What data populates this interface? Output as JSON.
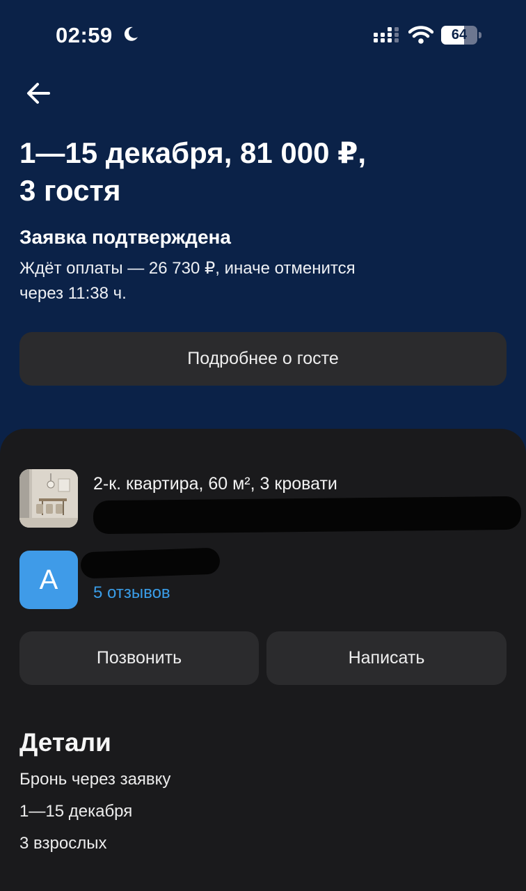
{
  "status_bar": {
    "time": "02:59",
    "battery_level": "64",
    "battery_fraction": 0.64,
    "icons": [
      "moon-icon",
      "signal-icon",
      "wifi-icon",
      "battery-icon"
    ]
  },
  "header": {
    "back_icon": "arrow-left-icon",
    "title_line1": "1—15 декабря, 81 000 ₽,",
    "title_line2": "3 гостя"
  },
  "booking_status": {
    "title": "Заявка подтверждена",
    "line1": "Ждёт оплаты — 26 730 ₽, иначе отменится",
    "line2": "через 11:38 ч."
  },
  "guest_button": {
    "label": "Подробнее о госте"
  },
  "listing": {
    "title": "2-к. квартира, 60 м², 3 кровати",
    "thumbnail_icon": "apartment-photo"
  },
  "host": {
    "avatar_letter": "А",
    "reviews_label": "5 отзывов"
  },
  "actions": {
    "call_label": "Позвонить",
    "write_label": "Написать"
  },
  "details": {
    "title": "Детали",
    "lines": [
      "Бронь через заявку",
      "1—15 декабря",
      "3 взрослых"
    ]
  },
  "colors": {
    "header_bg": "#0b2248",
    "sheet_bg": "#1a1a1c",
    "button_bg": "#2b2b2d",
    "accent_blue": "#3a9de8",
    "avatar_bg": "#3f9be8"
  }
}
